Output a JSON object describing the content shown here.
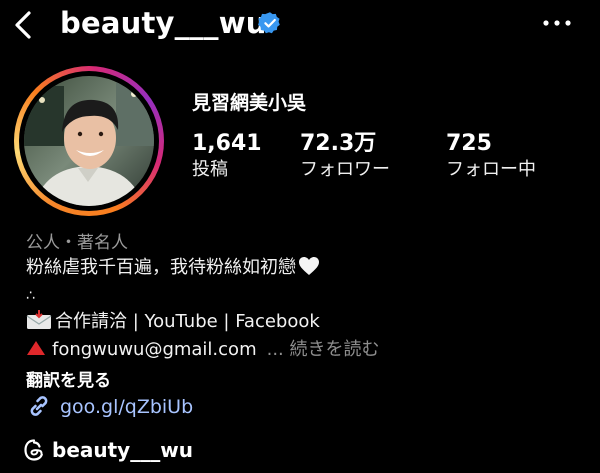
{
  "header": {
    "username": "beauty___wu",
    "back_icon": "chevron-left-icon",
    "verified_icon": "verified-badge-icon",
    "more_icon": "more-horizontal-icon"
  },
  "profile": {
    "full_name": "見習網美小吳",
    "stats": [
      {
        "value": "1,641",
        "label": "投稿"
      },
      {
        "value": "72.3万",
        "label": "フォロワー"
      },
      {
        "value": "725",
        "label": "フォロー中"
      }
    ],
    "category": "公人・著名人",
    "bio": {
      "line1": "粉絲虐我千百遍，我待粉絲如初戀",
      "line2": "∴",
      "line3": "合作請洽 | YouTube | Facebook",
      "line4": "fongwuwu@gmail.com",
      "more": "... 続きを読む"
    },
    "translate": "翻訳を見る",
    "link": "goo.gl/qZbiUb",
    "threads_handle": "beauty___wu"
  },
  "colors": {
    "background": "#000000",
    "verified": "#3897f0",
    "link": "#a8c4ff",
    "muted": "#9a9a9a"
  }
}
